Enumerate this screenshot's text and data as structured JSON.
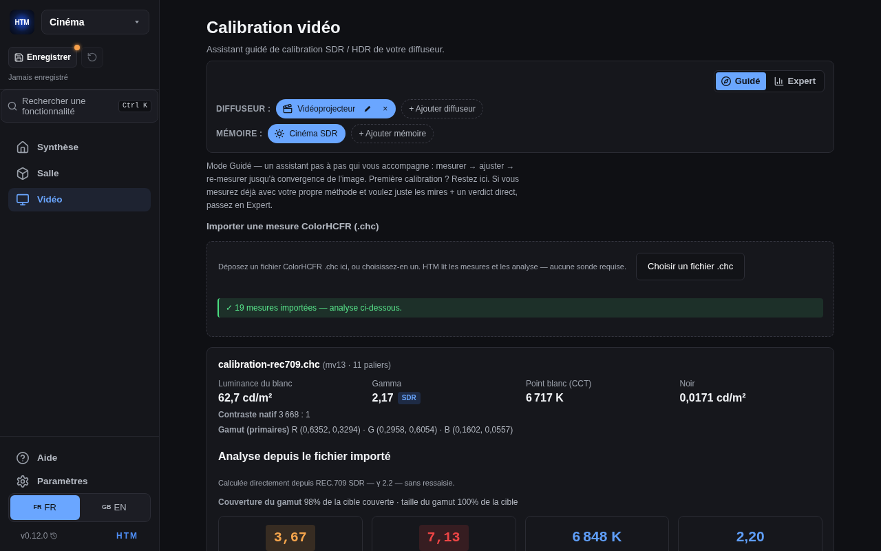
{
  "sidebar": {
    "logo": "HTM",
    "profile_select": {
      "value": "Cinéma"
    },
    "save_button": {
      "label": "Enregistrer",
      "unsaved": true
    },
    "reset_button": {
      "disabled": true
    },
    "save_status": "Jamais enregistré",
    "search": {
      "placeholder": "Rechercher une fonctionnalité",
      "shortcut": "Ctrl K"
    },
    "nav": [
      {
        "label": "Synthèse",
        "selected": false
      },
      {
        "label": "Salle",
        "selected": false
      },
      {
        "label": "Vidéo",
        "selected": true
      }
    ],
    "footer_nav": [
      {
        "label": "Aide"
      },
      {
        "label": "Paramètres"
      }
    ],
    "languages": [
      {
        "flag": "FR",
        "label": "FR",
        "selected": true
      },
      {
        "flag": "GB",
        "label": "EN",
        "selected": false
      }
    ],
    "version": "v0.12.0",
    "brand": "HTM"
  },
  "header": {
    "title": "Calibration vidéo",
    "subtitle": "Assistant guidé de calibration SDR / HDR de votre diffuseur."
  },
  "setup": {
    "modes": [
      {
        "label": "Guidé",
        "selected": true
      },
      {
        "label": "Expert",
        "selected": false
      }
    ],
    "rows": [
      {
        "label": "DIFFUSEUR :",
        "chips": [
          {
            "label": "Vidéoprojecteur",
            "selected": true,
            "editable": true,
            "remove": "×"
          }
        ],
        "add": "+ Ajouter diffuseur"
      },
      {
        "label": "MÉMOIRE :",
        "chips": [
          {
            "label": "Cinéma SDR",
            "selected": true,
            "editable": false
          }
        ],
        "add": "+ Ajouter mémoire"
      }
    ]
  },
  "mode_description": "Mode Guidé — un assistant pas à pas qui vous accompagne : mesurer → ajuster → re-mesurer jusqu'à convergence de l'image. Première calibration ? Restez ici. Si vous mesurez déjà avec votre propre méthode et voulez juste les mires + un verdict direct, passez en Expert.",
  "import": {
    "heading": "Importer une mesure ColorHCFR (.chc)",
    "hint": "Déposez un fichier ColorHCFR .chc ici, ou choisissez-en un. HTM lit les mesures et les analyse — aucune sonde requise.",
    "button": "Choisir un fichier .chc",
    "success": "✓ 19 mesures importées — analyse ci-dessous."
  },
  "file_card": {
    "file_name": "calibration-rec709.chc",
    "file_meta": "(mv13 · 11 paliers)",
    "metrics": [
      {
        "label": "Luminance du blanc",
        "value": "62,7 cd/m²"
      },
      {
        "label": "Gamma",
        "value": "2,17",
        "badge": "SDR"
      },
      {
        "label": "Point blanc (CCT)",
        "value": "6 717 K"
      },
      {
        "label": "Noir",
        "value": "0,0171 cd/m²"
      }
    ],
    "contrast": "**Contraste natif** 3 668 : 1",
    "gamut": "**Gamut (primaires)** R (0,6352, 0,3294) · G (0,2958, 0,6054) · B (0,1602, 0,0557)",
    "analysis": {
      "heading": "Analyse depuis le fichier importé",
      "note": "Calculée directement depuis REC.709 SDR — γ 2.2 — sans ressaisie.",
      "coverage": "**Couverture du gamut** 98% de la cible couverte · taille du gamut 100% de la cible",
      "stats": [
        {
          "kind": "tile",
          "value": "3,67",
          "color": "#f6a54c"
        },
        {
          "kind": "tile",
          "value": "7,13",
          "color": "#f04545"
        },
        {
          "kind": "plain",
          "value": "6 848 K",
          "color": "#5f9ef8"
        },
        {
          "kind": "plain",
          "value": "2,20",
          "color": "#5f9ef8"
        }
      ]
    }
  }
}
